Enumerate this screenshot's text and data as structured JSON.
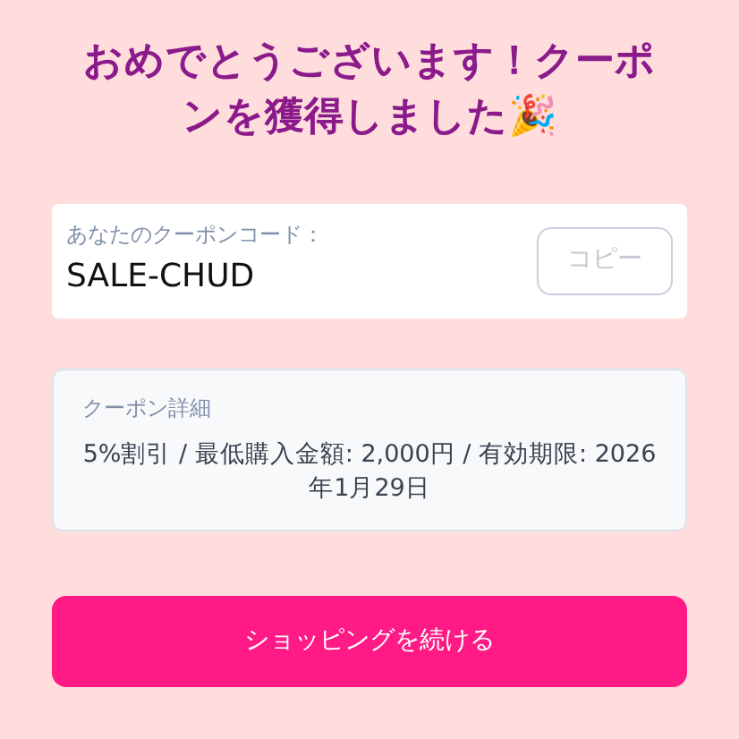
{
  "title": "おめでとうございます！クーポンを獲得しました🎉",
  "coupon": {
    "label": "あなたのクーポンコード：",
    "code": "SALE-CHUD",
    "copy_button": {
      "label": "コピー",
      "disabled": true
    }
  },
  "details": {
    "heading": "クーポン詳細",
    "text": "5%割引 / 最低購入金額: 2,000円 / 有効期限: 2026年1月29日"
  },
  "continue_button": "ショッピングを続ける"
}
